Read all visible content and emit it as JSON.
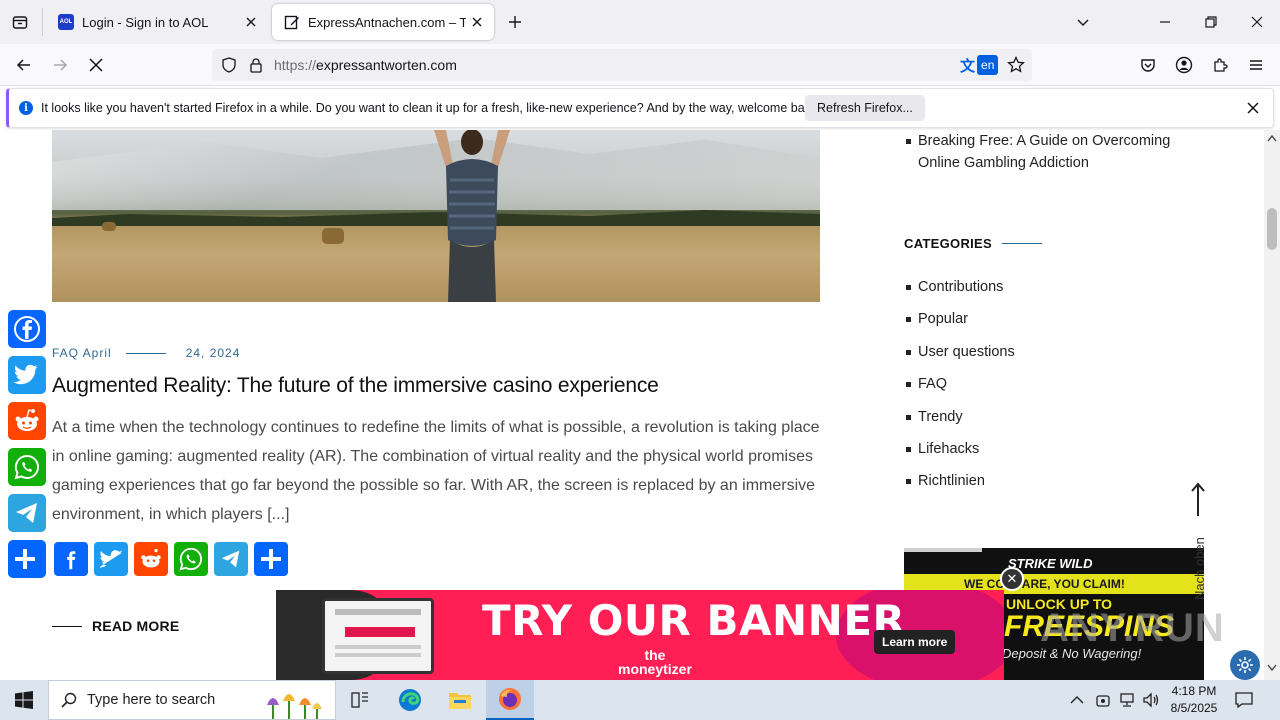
{
  "browser": {
    "tabs": [
      {
        "title": "Login - Sign in to AOL",
        "favicon": "aol-icon",
        "favicon_text": "AOL",
        "active": false
      },
      {
        "title": "ExpressAntnachen.com – The m",
        "favicon": "edit-page-icon",
        "active": true
      }
    ],
    "url_scheme": "https://",
    "url_host": "expressantworten.com",
    "translate_lang": "en"
  },
  "notification": {
    "message": "It looks like you haven't started Firefox in a while. Do you want to clean it up for a fresh, like-new experience? And by the way, welcome back!",
    "button": "Refresh Firefox..."
  },
  "post": {
    "category": "FAQ April",
    "date": "24, 2024",
    "title": "Augmented Reality: The future of the immersive casino experience",
    "excerpt": "At a time when the technology continues to redefine the limits of what is possible, a revolution is taking place in online gaming: augmented reality (AR). The combination of virtual reality and the physical world promises gaming experiences that go far beyond the possible so far. With AR, the screen is replaced by an immersive environment, in which players [...]",
    "read_more": "READ MORE"
  },
  "sidebar": {
    "recent_post": "Breaking Free: A Guide on Overcoming Online Gambling Addiction",
    "categories_heading": "CATEGORIES",
    "categories": [
      "Contributions",
      "Popular",
      "User questions",
      "FAQ",
      "Trendy",
      "Lifehacks",
      "Richtlinien"
    ],
    "back_to_top": "Nach oben"
  },
  "ads": {
    "banner_headline": "TRY OUR BANNER",
    "banner_brand_1": "the",
    "banner_brand_2": "moneytizer",
    "banner_cta": "Learn more",
    "side_brand": "STRIKE WILD",
    "side_tagline": "WE COMPARE, YOU CLAIM!",
    "side_unlock": "UNLOCK UP TO",
    "side_spins": "FREESPINS",
    "side_deposit": "Deposit & No Wagering!"
  },
  "watermark": "ANY.RUN",
  "taskbar": {
    "search_placeholder": "Type here to search",
    "time": "4:18 PM",
    "date": "8/5/2025"
  },
  "colors": {
    "accent": "#2e6a92",
    "firefox_blue": "#0061e0",
    "banner_pink": "#ff1f55"
  }
}
